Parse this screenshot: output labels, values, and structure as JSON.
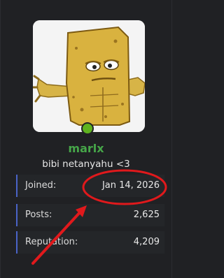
{
  "profile": {
    "username": "marlx",
    "tagline": "bibi netanyahu <3",
    "avatar": "yellow-sponge-character-avatar",
    "status_color": "#5fb31f",
    "username_color": "#46a649"
  },
  "stats": [
    {
      "label": "Joined:",
      "value": "Jan 14, 2026"
    },
    {
      "label": "Posts:",
      "value": "2,625"
    },
    {
      "label": "Reputation:",
      "value": "4,209"
    }
  ],
  "annotations": {
    "highlight_color": "#e0191c"
  },
  "colors": {
    "accent": "#4a63c7",
    "background": "#202124"
  }
}
